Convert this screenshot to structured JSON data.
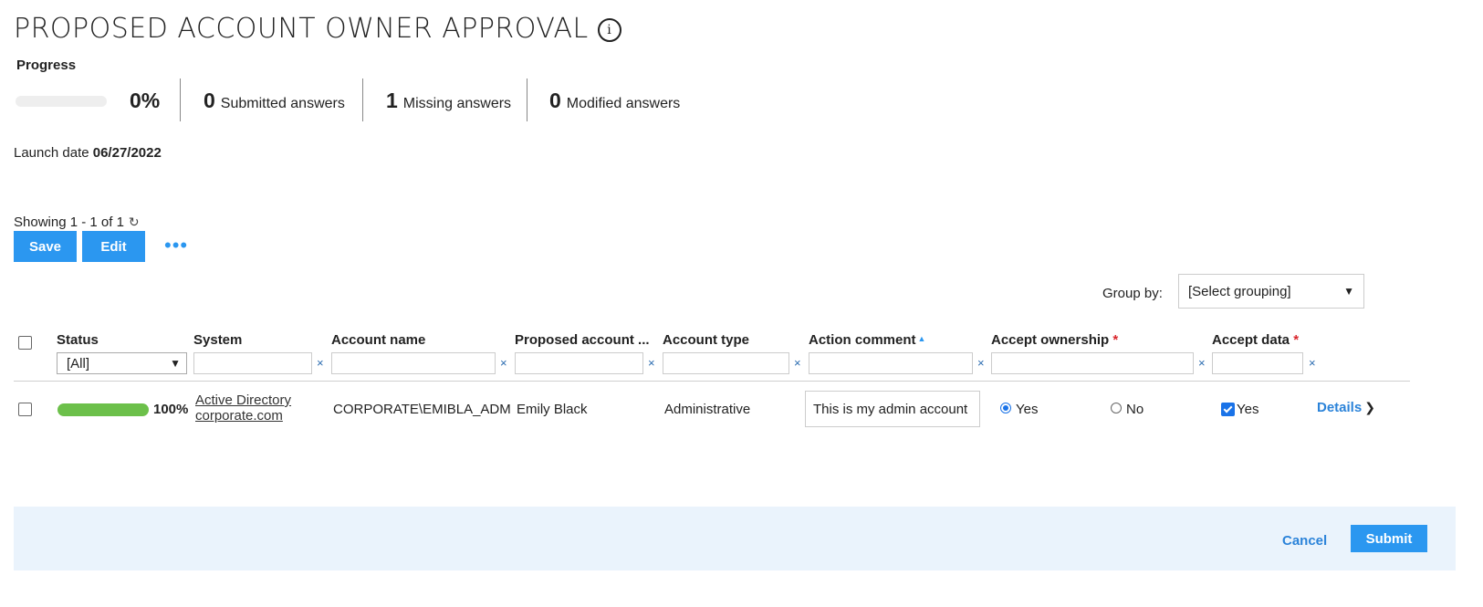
{
  "page": {
    "title": "PROPOSED ACCOUNT OWNER APPROVAL",
    "info_icon": "info-icon"
  },
  "progress": {
    "label": "Progress",
    "percent": 0,
    "percent_text": "0%",
    "submitted_count": "0",
    "submitted_label": "Submitted answers",
    "missing_count": "1",
    "missing_label": "Missing answers",
    "modified_count": "0",
    "modified_label": "Modified answers"
  },
  "launch": {
    "label": "Launch date",
    "date": "06/27/2022"
  },
  "toolbar": {
    "showing": "Showing 1 - 1 of 1",
    "refresh_icon": "refresh-icon",
    "save_label": "Save",
    "edit_label": "Edit",
    "more_icon": "more-horizontal-icon"
  },
  "grouping": {
    "label": "Group by:",
    "selected": "[Select grouping]"
  },
  "table": {
    "columns": {
      "status": "Status",
      "system": "System",
      "account_name": "Account name",
      "proposed_owner": "Proposed account ...",
      "account_type": "Account type",
      "action_comment": "Action comment",
      "accept_ownership": "Accept ownership",
      "accept_data": "Accept data",
      "required_mark": "*"
    },
    "status_filter": "[All]",
    "clear_symbol": "×",
    "rows": [
      {
        "status_percent": 100,
        "status_text": "100%",
        "system_line1": "Active Directory",
        "system_line2": "corporate.com",
        "account_name": "CORPORATE\\EMIBLA_ADM",
        "proposed_owner": "Emily Black",
        "account_type": "Administrative",
        "action_comment": "This is my admin account",
        "ownership_yes": "Yes",
        "ownership_no": "No",
        "ownership_selected": "Yes",
        "accept_data_label": "Yes",
        "accept_data_checked": true,
        "details_label": "Details"
      }
    ]
  },
  "footer": {
    "cancel_label": "Cancel",
    "submit_label": "Submit"
  },
  "colors": {
    "accent": "#2b97f0",
    "status_green": "#6cc04a",
    "required_red": "#d9262c",
    "footer_bg": "#eaf3fc"
  }
}
